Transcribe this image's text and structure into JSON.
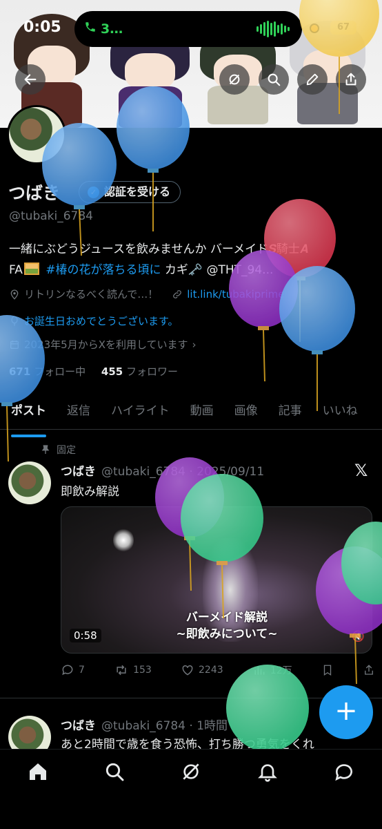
{
  "status_bar": {
    "time": "0:05",
    "call_label": "3…",
    "battery": "67"
  },
  "profile": {
    "name": "つばき",
    "verify_label": "認証を受ける",
    "handle": "@tubaki_6784",
    "bio_part1": "一緒にぶどうジュースを飲みませんか バーメイド𝑺騎士𝑨",
    "bio_part2": "FA",
    "bio_tag": "#椿の花が落ちる頃に",
    "bio_part3": "カギ🗝️ @THT_94...",
    "location": "リトリンなるべく読んで…！",
    "link": "lit.link/tubakiprime",
    "birthday": "お誕生日おめでとうございます。",
    "joined": "2023年5月からXを利用しています",
    "following_count": "671",
    "following_label": "フォロー中",
    "followers_count": "455",
    "followers_label": "フォロワー"
  },
  "tabs": [
    "ポスト",
    "返信",
    "ハイライト",
    "動画",
    "画像",
    "記事",
    "いいね"
  ],
  "pinned_label": "固定",
  "posts": [
    {
      "name": "つばき",
      "meta": "@tubaki_6784 · 2025/09/11",
      "text": "即飲み解説",
      "video_caption_1": "バーメイド解説",
      "video_caption_2": "~即飲みについて~",
      "duration": "0:58",
      "replies": "7",
      "reposts": "153",
      "likes": "2243",
      "views": "12万"
    },
    {
      "name": "つばき",
      "meta": "@tubaki_6784 · 1時間",
      "text": "あと2時間で歳を食う恐怖、打ち勝つ勇気をくれ"
    }
  ],
  "colors": {
    "accent": "#1d9bf0",
    "call_green": "#30d158"
  },
  "balloon_colors": {
    "blue": "#3f8fe0",
    "red": "#d9374f",
    "purple": "#8e2fc4",
    "green": "#37c98a",
    "yellow": "#f2c94c"
  }
}
